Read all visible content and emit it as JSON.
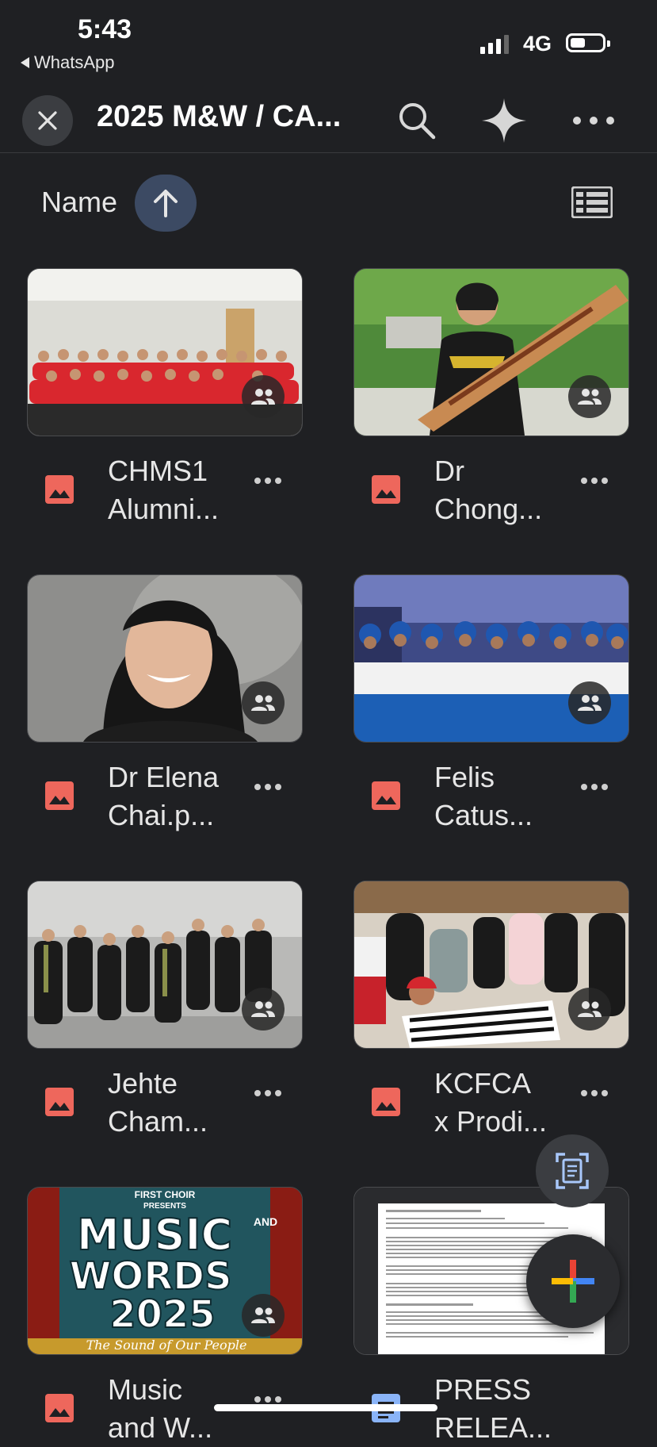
{
  "status_bar": {
    "time": "5:43",
    "back_app": "WhatsApp",
    "network": "4G",
    "signal_bars": 3,
    "battery_level": 0.4
  },
  "header": {
    "title": "2025 M&W / CA...",
    "close_icon": "close-icon",
    "search_icon": "search-icon",
    "gemini_icon": "sparkle-icon",
    "more_icon": "more-horizontal-icon"
  },
  "sort": {
    "label": "Name",
    "direction_icon": "arrow-up-icon",
    "view_icon": "list-view-icon"
  },
  "files": [
    {
      "line1": "CHMS1",
      "line2": "Alumni...",
      "type": "image",
      "shared": true
    },
    {
      "line1": "Dr",
      "line2": "Chong...",
      "type": "image",
      "shared": true
    },
    {
      "line1": "Dr Elena",
      "line2": "Chai.p...",
      "type": "image",
      "shared": true
    },
    {
      "line1": "Felis",
      "line2": "Catus...",
      "type": "image",
      "shared": true
    },
    {
      "line1": "Jehte",
      "line2": "Cham...",
      "type": "image",
      "shared": true
    },
    {
      "line1": "KCFCA",
      "line2": "x Prodi...",
      "type": "image",
      "shared": true
    },
    {
      "line1": "Music",
      "line2": "and W...",
      "type": "image",
      "shared": true
    },
    {
      "line1": "PRESS",
      "line2": "RELEA...",
      "type": "document",
      "shared": false
    }
  ],
  "poster": {
    "top": "FIRST CHOIR",
    "presents": "PRESENTS",
    "music": "MUSIC",
    "and": "AND",
    "words": "WORDS",
    "year": "2025",
    "tagline": "The Sound of Our People"
  },
  "fabs": {
    "scan_icon": "document-scan-icon",
    "new_icon": "plus-icon"
  },
  "colors": {
    "background": "#1f2023",
    "image_type": "#ee675c",
    "doc_type": "#8ab4f8",
    "sort_chip": "#3c4a63"
  }
}
